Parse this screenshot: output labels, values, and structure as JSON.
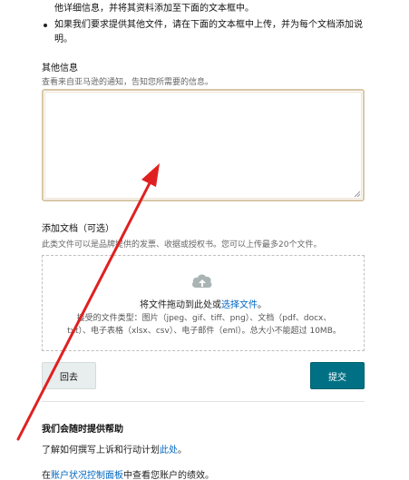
{
  "instructions": {
    "bullet1_continuation": "他详细信息，并将其资料添加至下面的文本框中。",
    "bullet2": "如果我们要求提供其他文件，请在下面的文本框中上传，并为每个文档添加说明。"
  },
  "other_info": {
    "label": "其他信息",
    "hint": "查看来自亚马逊的通知，告知您所需要的信息。",
    "value": ""
  },
  "attachments": {
    "label": "添加文档（可选）",
    "hint": "此类文件可以是品牌提供的发票、收据或授权书。您可以上传最多20个文件。",
    "drop_prefix": "将文件拖动到此处或",
    "drop_link": "选择文件",
    "drop_suffix": "。",
    "types_line1": "接受的文件类型：图片（jpeg、gif、tiff、png）、文档（pdf、docx、",
    "types_line2": "txt）、电子表格（xlsx、csv）、电子邮件（eml）。总大小不能超过 10MB。"
  },
  "buttons": {
    "back": "回去",
    "submit": "提交"
  },
  "help": {
    "title": "我们会随时提供帮助",
    "line1_prefix": "了解如何撰写上诉和行动计划",
    "line1_link": "此处",
    "line1_suffix": "。",
    "line2_prefix": "在",
    "line2_link": "账户状况控制面板",
    "line2_suffix": "中查看您账户的绩效。"
  },
  "colors": {
    "accent": "#007185",
    "link": "#0066c0",
    "annotation_arrow": "#e02020"
  },
  "icons": {
    "upload": "cloud-upload-icon",
    "annotation": "red-arrow-annotation"
  }
}
